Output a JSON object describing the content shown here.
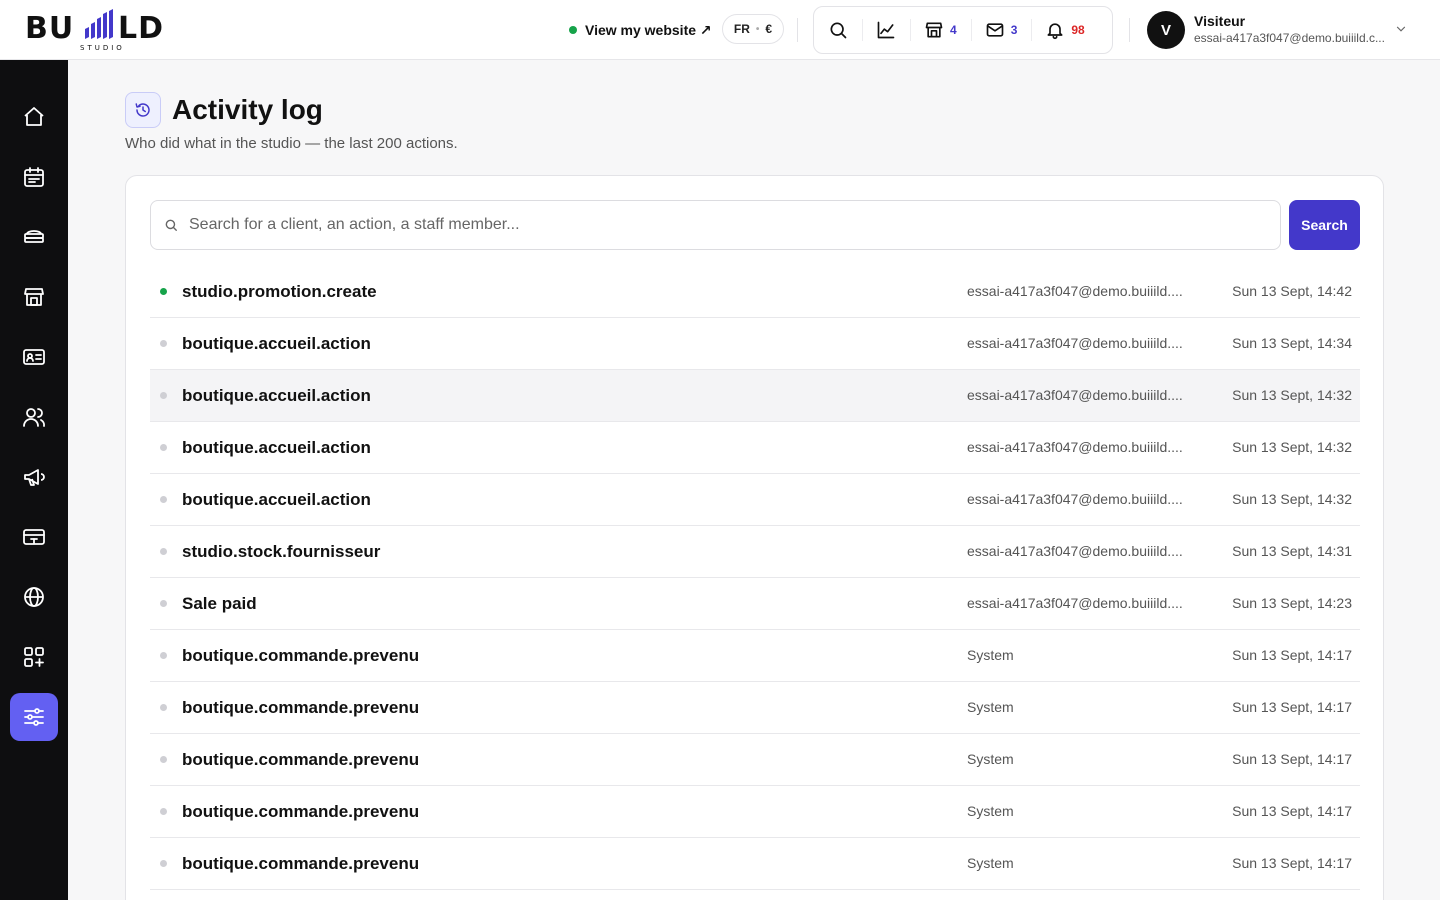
{
  "header": {
    "logo_text": "BUILD STUDIO",
    "view_site_label": "View my website ↗",
    "lang": "FR",
    "currency": "€",
    "toolbar": {
      "store_count": "4",
      "mail_count": "3",
      "notif_count": "98"
    },
    "user": {
      "initial": "V",
      "name": "Visiteur",
      "email": "essai-a417a3f047@demo.buiiild.c..."
    }
  },
  "sidebar": {
    "items": [
      "home-icon",
      "calendar-icon",
      "courses-icon",
      "store-icon",
      "member-card-icon",
      "users-icon",
      "megaphone-icon",
      "payment-icon",
      "globe-icon",
      "apps-icon",
      "settings-sliders-icon"
    ],
    "active": "settings-sliders-icon"
  },
  "page": {
    "title": "Activity log",
    "subtitle": "Who did what in the studio — the last 200 actions."
  },
  "search": {
    "placeholder": "Search for a client, an action, a staff member...",
    "value": "",
    "button_label": "Search"
  },
  "log": [
    {
      "action": "studio.promotion.create",
      "actor": "essai-a417a3f047@demo.buiiild....",
      "time": "Sun 13 Sept, 14:42",
      "status": "new"
    },
    {
      "action": "boutique.accueil.action",
      "actor": "essai-a417a3f047@demo.buiiild....",
      "time": "Sun 13 Sept, 14:34",
      "status": "read"
    },
    {
      "action": "boutique.accueil.action",
      "actor": "essai-a417a3f047@demo.buiiild....",
      "time": "Sun 13 Sept, 14:32",
      "status": "read"
    },
    {
      "action": "boutique.accueil.action",
      "actor": "essai-a417a3f047@demo.buiiild....",
      "time": "Sun 13 Sept, 14:32",
      "status": "read"
    },
    {
      "action": "boutique.accueil.action",
      "actor": "essai-a417a3f047@demo.buiiild....",
      "time": "Sun 13 Sept, 14:32",
      "status": "read"
    },
    {
      "action": "studio.stock.fournisseur",
      "actor": "essai-a417a3f047@demo.buiiild....",
      "time": "Sun 13 Sept, 14:31",
      "status": "read"
    },
    {
      "action": "Sale paid",
      "actor": "essai-a417a3f047@demo.buiiild....",
      "time": "Sun 13 Sept, 14:23",
      "status": "read"
    },
    {
      "action": "boutique.commande.prevenu",
      "actor": "System",
      "time": "Sun 13 Sept, 14:17",
      "status": "read"
    },
    {
      "action": "boutique.commande.prevenu",
      "actor": "System",
      "time": "Sun 13 Sept, 14:17",
      "status": "read"
    },
    {
      "action": "boutique.commande.prevenu",
      "actor": "System",
      "time": "Sun 13 Sept, 14:17",
      "status": "read"
    },
    {
      "action": "boutique.commande.prevenu",
      "actor": "System",
      "time": "Sun 13 Sept, 14:17",
      "status": "read"
    },
    {
      "action": "boutique.commande.prevenu",
      "actor": "System",
      "time": "Sun 13 Sept, 14:17",
      "status": "read"
    }
  ],
  "colors": {
    "accent": "#4338ca",
    "sidebar_active": "#6360f2",
    "sidebar_bg": "#0e0e10",
    "status_new": "#16a34a",
    "notif": "#dc2626"
  }
}
